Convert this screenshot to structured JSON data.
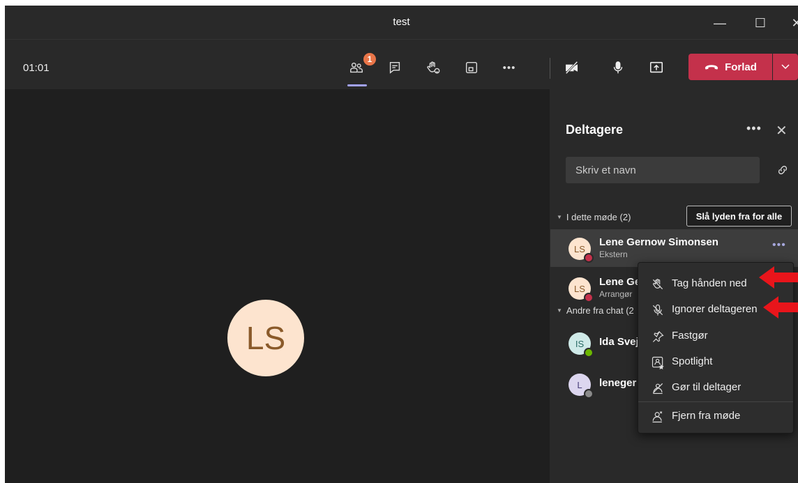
{
  "window": {
    "title": "test",
    "minimize": "—",
    "maximize": "☐",
    "close": "✕"
  },
  "toolbar": {
    "timer": "01:01",
    "participants_badge": "1",
    "icons": [
      "participants-icon",
      "chat-icon",
      "raise-hand-icon",
      "rooms-icon",
      "more-icon",
      "camera-off-icon",
      "microphone-icon",
      "share-icon"
    ],
    "more_label": "•••",
    "leave_label": "Forlad"
  },
  "stage": {
    "avatar_initials": "LS"
  },
  "panel": {
    "title": "Deltagere",
    "more_label": "•••",
    "close_label": "✕",
    "search_placeholder": "Skriv et navn",
    "section_in_meeting": "I dette møde (2)",
    "mute_all_label": "Slå lyden fra for alle",
    "section_other": "Andre fra chat (2",
    "participants": [
      {
        "initials": "LS",
        "name": "Lene Gernow Simonsen",
        "role": "Ekstern",
        "avatar_bg": "#fde4cf",
        "avatar_fg": "#8a5a2a",
        "status": "#c4314b"
      },
      {
        "initials": "LS",
        "name": "Lene Ge",
        "role": "Arrangør",
        "avatar_bg": "#fde4cf",
        "avatar_fg": "#8a5a2a",
        "status": "#c4314b"
      },
      {
        "initials": "IS",
        "name": "Ida Svej",
        "role": "",
        "avatar_bg": "#cfeae8",
        "avatar_fg": "#2a6b65",
        "status": "#6bb700"
      },
      {
        "initials": "L",
        "name": "leneger",
        "role": "",
        "avatar_bg": "#dcd6ef",
        "avatar_fg": "#4a3f7a",
        "status": "#8a8a8a"
      }
    ],
    "row_more": "•••"
  },
  "context_menu": {
    "items": [
      {
        "label": "Tag hånden ned",
        "icon": "lower-hand-icon"
      },
      {
        "label": "Ignorer deltageren",
        "icon": "mute-participant-icon"
      },
      {
        "label": "Fastgør",
        "icon": "pin-icon"
      },
      {
        "label": "Spotlight",
        "icon": "spotlight-icon"
      },
      {
        "label": "Gør til deltager",
        "icon": "make-attendee-icon"
      },
      {
        "label": "Fjern fra møde",
        "icon": "remove-person-icon"
      }
    ]
  },
  "colors": {
    "accent": "#a2a2f5",
    "leave": "#c4314b",
    "badge": "#e97548",
    "annotation_arrow": "#e8151b"
  }
}
